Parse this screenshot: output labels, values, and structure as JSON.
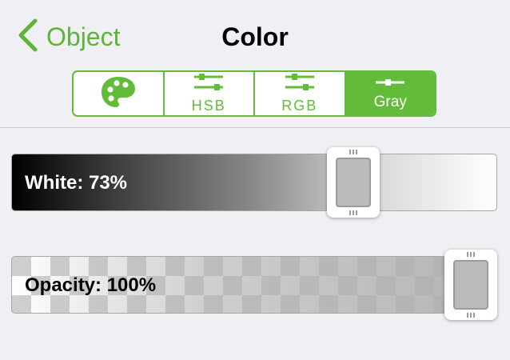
{
  "nav": {
    "back_label": "Object",
    "title": "Color"
  },
  "segments": [
    {
      "id": "palette",
      "label": "",
      "icon": "palette-icon",
      "active": false
    },
    {
      "id": "hsb",
      "label": "HSB",
      "icon": "sliders-icon",
      "active": false
    },
    {
      "id": "rgb",
      "label": "RGB",
      "icon": "sliders-icon",
      "active": false
    },
    {
      "id": "gray",
      "label": "Gray",
      "icon": "slider-icon",
      "active": true
    }
  ],
  "sliders": {
    "white": {
      "label": "White: 73%",
      "value": 0.73
    },
    "opacity": {
      "label": "Opacity: 100%",
      "value": 1.0
    }
  },
  "colors": {
    "accent": "#63bb3a",
    "background": "#efeff4",
    "thumb_swatch": "#bbbbbb"
  }
}
